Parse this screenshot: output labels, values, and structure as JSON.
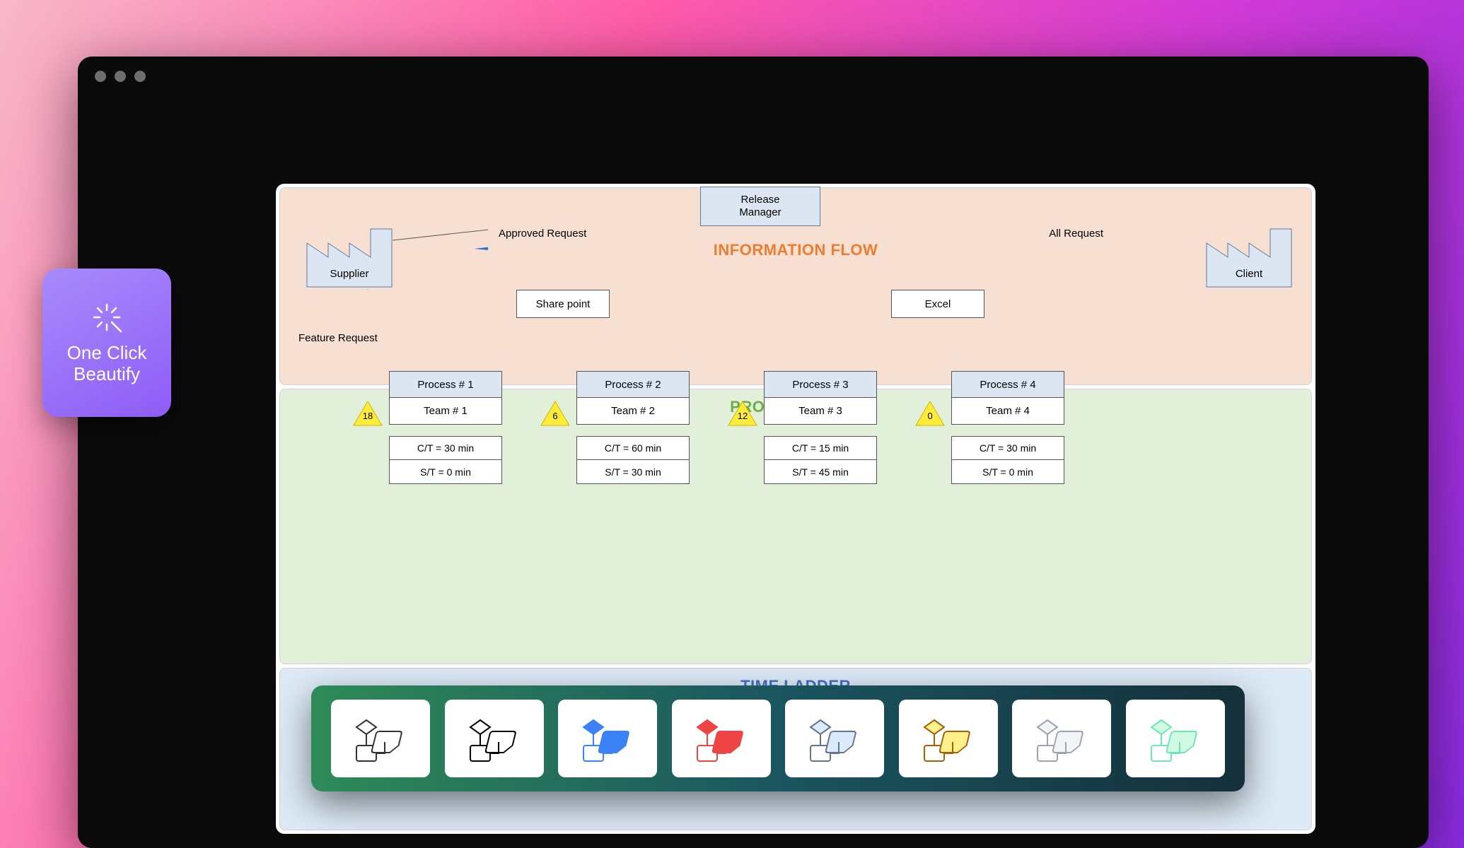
{
  "beautify": {
    "label": "One Click\nBeautify"
  },
  "sections": {
    "info": "INFORMATION FLOW",
    "product": "PRODUCT FLOW",
    "time": "TIME LADDER"
  },
  "entities": {
    "release_manager": "Release\nManager",
    "supplier": "Supplier",
    "client": "Client",
    "sharepoint": "Share point",
    "excel": "Excel"
  },
  "labels": {
    "approved": "Approved Request",
    "all_request": "All Request",
    "feature_request": "Feature Request"
  },
  "processes": [
    {
      "name": "Process # 1",
      "team": "Team # 1",
      "ct": "C/T = 30 min",
      "st": "S/T = 0 min",
      "wait": "18"
    },
    {
      "name": "Process # 2",
      "team": "Team # 2",
      "ct": "C/T = 60 min",
      "st": "S/T = 30 min",
      "wait": "6"
    },
    {
      "name": "Process # 3",
      "team": "Team # 3",
      "ct": "C/T = 15 min",
      "st": "S/T = 45 min",
      "wait": "12"
    },
    {
      "name": "Process # 4",
      "team": "Team # 4",
      "ct": "C/T =  30 min",
      "st": "S/T = 0 min",
      "wait": "0"
    }
  ],
  "toolbar_themes": [
    {
      "name": "default-white",
      "diamond": "#fff",
      "dstroke": "#333",
      "box": "#fff",
      "bstroke": "#333"
    },
    {
      "name": "bold-outline",
      "diamond": "#fff",
      "dstroke": "#000",
      "box": "#fff",
      "bstroke": "#000"
    },
    {
      "name": "blue",
      "diamond": "#3b82f6",
      "dstroke": "#3b82f6",
      "box": "#3b82f6",
      "bstroke": "#3b82f6"
    },
    {
      "name": "red",
      "diamond": "#ef4444",
      "dstroke": "#ef4444",
      "box": "#ef4444",
      "bstroke": "#ef4444"
    },
    {
      "name": "light-blue",
      "diamond": "#dbeafe",
      "dstroke": "#64748b",
      "box": "#dbeafe",
      "bstroke": "#64748b"
    },
    {
      "name": "yellow",
      "diamond": "#fef08a",
      "dstroke": "#a16207",
      "box": "#fef08a",
      "bstroke": "#a16207"
    },
    {
      "name": "gray",
      "diamond": "#f3f4f6",
      "dstroke": "#9ca3af",
      "box": "#f3f4f6",
      "bstroke": "#9ca3af"
    },
    {
      "name": "green",
      "diamond": "#d1fae5",
      "dstroke": "#6ee7b7",
      "box": "#d1fae5",
      "bstroke": "#6ee7b7"
    }
  ]
}
